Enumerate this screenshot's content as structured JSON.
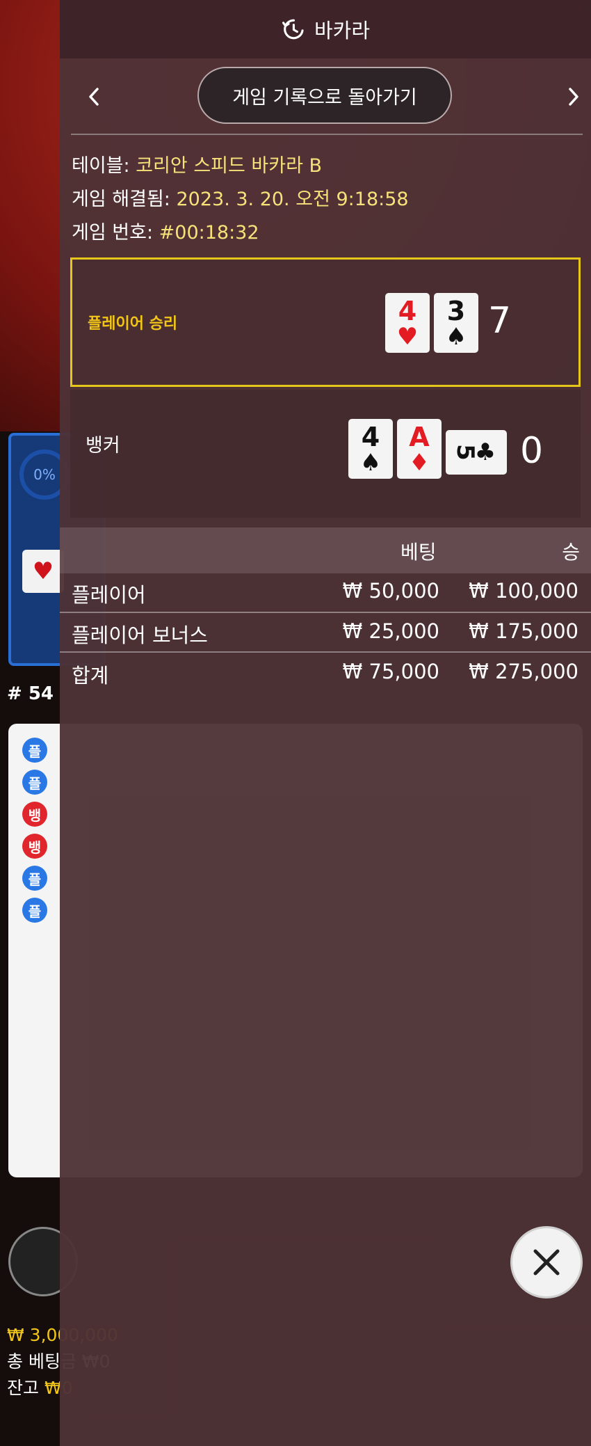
{
  "background": {
    "stat_percent": "0%",
    "round_label": "# 54",
    "road_marks": [
      "플",
      "플",
      "뱅",
      "뱅",
      "플",
      "플"
    ],
    "balance_line": "₩ 3,000,000",
    "total_bet_label": "총 베팅금 ₩0",
    "balance_label": "잔고",
    "balance_value": "₩0"
  },
  "header": {
    "title": "바카라",
    "icon": "history-icon"
  },
  "nav": {
    "back_label": "게임 기록으로 돌아가기",
    "prev_icon": "chevron-left-icon",
    "next_icon": "chevron-right-icon"
  },
  "info": {
    "table_label": "테이블:",
    "table_value": "코리안 스피드 바카라 B",
    "resolved_label": "게임 해결됨:",
    "resolved_value": "2023. 3. 20. 오전 9:18:58",
    "number_label": "게임 번호:",
    "number_value": "#00:18:32"
  },
  "results": {
    "player": {
      "label": "플레이어 승리",
      "cards": [
        {
          "rank": "4",
          "suit": "♥",
          "color": "red"
        },
        {
          "rank": "3",
          "suit": "♠",
          "color": "black"
        }
      ],
      "score": "7"
    },
    "banker": {
      "label": "뱅커",
      "cards": [
        {
          "rank": "4",
          "suit": "♠",
          "color": "black"
        },
        {
          "rank": "A",
          "suit": "♦",
          "color": "red"
        },
        {
          "rank": "5",
          "suit": "♣",
          "color": "black",
          "sideways": true
        }
      ],
      "score": "0"
    }
  },
  "bets": {
    "header_bet": "베팅",
    "header_win": "승",
    "rows": [
      {
        "name": "플레이어",
        "bet": "₩ 50,000",
        "win": "₩ 100,000"
      },
      {
        "name": "플레이어 보너스",
        "bet": "₩ 25,000",
        "win": "₩ 175,000"
      },
      {
        "name": "합계",
        "bet": "₩ 75,000",
        "win": "₩ 275,000"
      }
    ]
  },
  "colors": {
    "accent_gold": "#f2c618",
    "win_border": "#e6c619",
    "card_red": "#e31b23",
    "player_blue": "#2a78e6",
    "banker_red": "#e0262c"
  }
}
